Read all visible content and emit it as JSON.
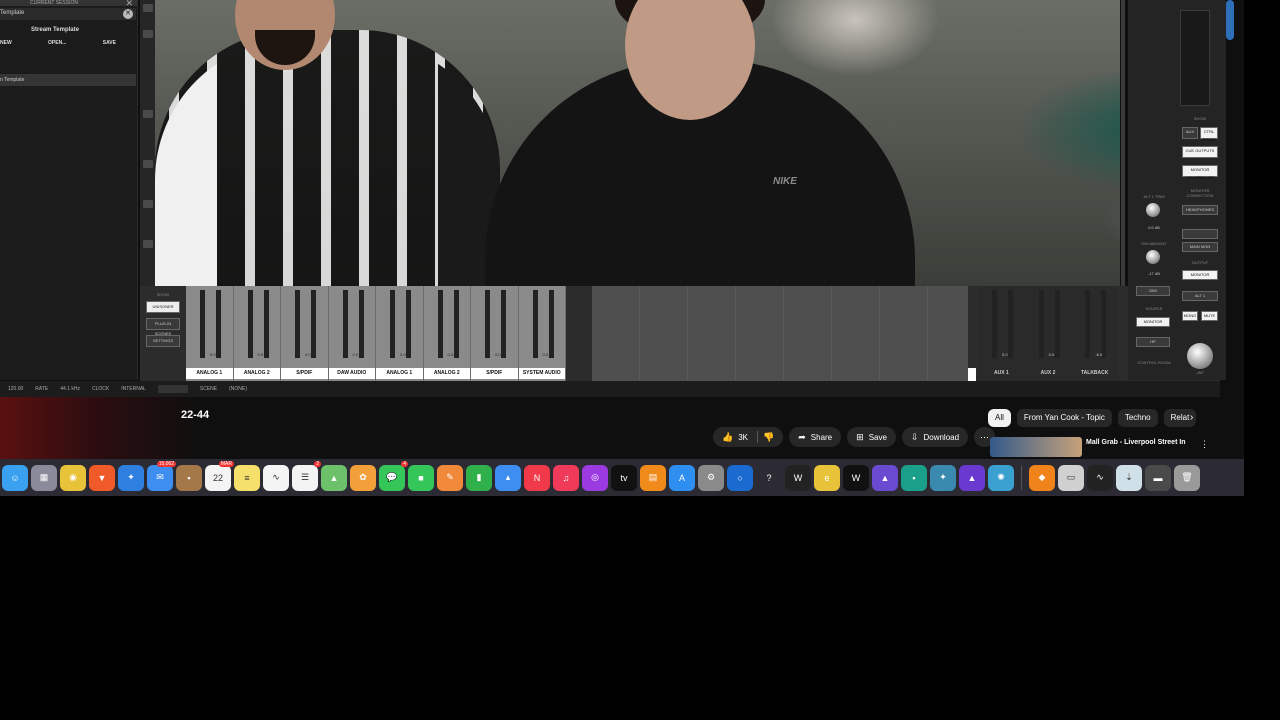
{
  "left_panel": {
    "header": "CURRENT SESSION",
    "template_row": "Template",
    "stream_title": "Stream Template",
    "buttons": [
      "NEW",
      "OPEN...",
      "SAVE"
    ],
    "selected_item": "n Template"
  },
  "mixer": {
    "show_label": "SHOW",
    "side_buttons": [
      "UNISONER",
      "PLUG-IN SCENES",
      "SETTINGS"
    ],
    "channels": [
      "ANALOG 1",
      "ANALOG 2",
      "S/PDIF",
      "DAW AUDIO",
      "ANALOG 1",
      "ANALOG 2",
      "S/PDIF",
      "SYSTEM AUDIO"
    ],
    "channel_db": [
      "0.0",
      "0.0",
      "0.0",
      "0.0",
      "0.0",
      "0.0",
      "0.0",
      "0.0"
    ],
    "aux_channels": [
      "AUX 1",
      "AUX 2",
      "TALKBACK"
    ],
    "aux_db": [
      "0.0",
      "0.0",
      "-6.0"
    ]
  },
  "right_panel": {
    "show": "SHOW",
    "buttons_top": [
      "AUX",
      "CTRL ROOM",
      "CUE OUTPUTS",
      "MONITOR CONTROLLER"
    ],
    "monitor_connection": "MONITOR CONNECTION",
    "headphones": "HEADPHONES",
    "alt_trim": "ALT 1 TRIM",
    "alt_trim_value": "0.0 dB",
    "main_mon": "MAIN MON",
    "dim_amount": "DIM AMOUNT",
    "dim_value": "-17 dB",
    "output": "OUTPUT",
    "monitor": "MONITOR",
    "dim": "DIM",
    "alt1": "ALT 1",
    "source": "SOURCE",
    "mono": "MONO",
    "mute": "MUTE",
    "source_monitor": "MONITOR",
    "hp": "HP",
    "control_room": "CONTROL ROOM",
    "knob_label": "-INF"
  },
  "status_bar": {
    "tempo": "120.00",
    "rate_label": "RATE",
    "rate": "44.1 kHz",
    "clock_label": "CLOCK",
    "clock": "INTERNAL",
    "scene_label": "SCENE",
    "scene": "(NONE)"
  },
  "video": {
    "title": "22-44",
    "nike_text": "NIKE",
    "actions": {
      "likes": "3K",
      "share": "Share",
      "save": "Save",
      "download": "Download"
    },
    "chips": [
      "All",
      "From Yan Cook - Topic",
      "Techno",
      "Relat"
    ],
    "recommended_title": "Mall Grab - Liverpool Street In"
  },
  "dock": {
    "icons": [
      {
        "name": "finder-icon",
        "color": "#3aa0f0",
        "glyph": "☺"
      },
      {
        "name": "launchpad-icon",
        "color": "#8a8a9a",
        "glyph": "▦"
      },
      {
        "name": "chrome-icon",
        "color": "#e8c33a",
        "glyph": "◉"
      },
      {
        "name": "brave-icon",
        "color": "#f05a28",
        "glyph": "▼"
      },
      {
        "name": "safari-icon",
        "color": "#2f7fe0",
        "glyph": "✦"
      },
      {
        "name": "mail-icon",
        "color": "#3d8ef0",
        "glyph": "✉",
        "badge": "15,062"
      },
      {
        "name": "notes-brown-icon",
        "color": "#a47848",
        "glyph": "▪"
      },
      {
        "name": "calendar-icon",
        "color": "#f4f4f4",
        "glyph": "22",
        "badge": "MAR"
      },
      {
        "name": "notes-icon",
        "color": "#f5e06b",
        "glyph": "≡"
      },
      {
        "name": "freeform-icon",
        "color": "#f4f4f4",
        "glyph": "∿"
      },
      {
        "name": "reminders-icon",
        "color": "#f4f4f4",
        "glyph": "☰",
        "badge": "2"
      },
      {
        "name": "maps-icon",
        "color": "#6cc16a",
        "glyph": "▲"
      },
      {
        "name": "photos-icon",
        "color": "#f4a03a",
        "glyph": "✿"
      },
      {
        "name": "messages-icon",
        "color": "#35c65a",
        "glyph": "💬",
        "badge": "4"
      },
      {
        "name": "facetime-icon",
        "color": "#35c65a",
        "glyph": "■"
      },
      {
        "name": "pages-icon",
        "color": "#f08a3a",
        "glyph": "✎"
      },
      {
        "name": "numbers-icon",
        "color": "#2fb04a",
        "glyph": "▮"
      },
      {
        "name": "keynote-icon",
        "color": "#3d8ef0",
        "glyph": "▴"
      },
      {
        "name": "news-icon",
        "color": "#f03a4a",
        "glyph": "N"
      },
      {
        "name": "music-icon",
        "color": "#f03a5a",
        "glyph": "♫"
      },
      {
        "name": "podcasts-icon",
        "color": "#9a3ae0",
        "glyph": "◎"
      },
      {
        "name": "appletv-icon",
        "color": "#111111",
        "glyph": "tv"
      },
      {
        "name": "books-icon",
        "color": "#f08a1a",
        "glyph": "▤"
      },
      {
        "name": "appstore-icon",
        "color": "#2f8ff0",
        "glyph": "A"
      },
      {
        "name": "settings-icon",
        "color": "#8a8a8a",
        "glyph": "⚙"
      },
      {
        "name": "proton-icon",
        "color": "#1a6ad0",
        "glyph": "○"
      },
      {
        "name": "help-icon",
        "color": "#2c2a33",
        "glyph": "?"
      },
      {
        "name": "wsb-icon",
        "color": "#222222",
        "glyph": "W"
      },
      {
        "name": "email-e-icon",
        "color": "#e8c33a",
        "glyph": "e"
      },
      {
        "name": "waves-icon",
        "color": "#111111",
        "glyph": "W"
      },
      {
        "name": "ua-connect-icon",
        "color": "#6a4ad0",
        "glyph": "▲"
      },
      {
        "name": "terminal-app-icon",
        "color": "#1aa08a",
        "glyph": "▪"
      },
      {
        "name": "ua-console-icon",
        "color": "#3a8ab0",
        "glyph": "✦"
      },
      {
        "name": "pro-tools-icon",
        "color": "#6a3ad0",
        "glyph": "▲"
      },
      {
        "name": "luna-icon",
        "color": "#3aa0d0",
        "glyph": "✺"
      },
      {
        "name": "fl-studio-icon",
        "color": "#f0841a",
        "glyph": "◆"
      },
      {
        "name": "finder-window-icon",
        "color": "#d0d0d0",
        "glyph": "▭"
      },
      {
        "name": "activity-monitor-icon",
        "color": "#222222",
        "glyph": "∿"
      },
      {
        "name": "downloads-icon",
        "color": "#d0e0e8",
        "glyph": "⇣"
      },
      {
        "name": "folder-icon",
        "color": "#4a4a4a",
        "glyph": "▬"
      },
      {
        "name": "trash-icon",
        "color": "#9a9a9a",
        "glyph": "🗑"
      }
    ]
  }
}
